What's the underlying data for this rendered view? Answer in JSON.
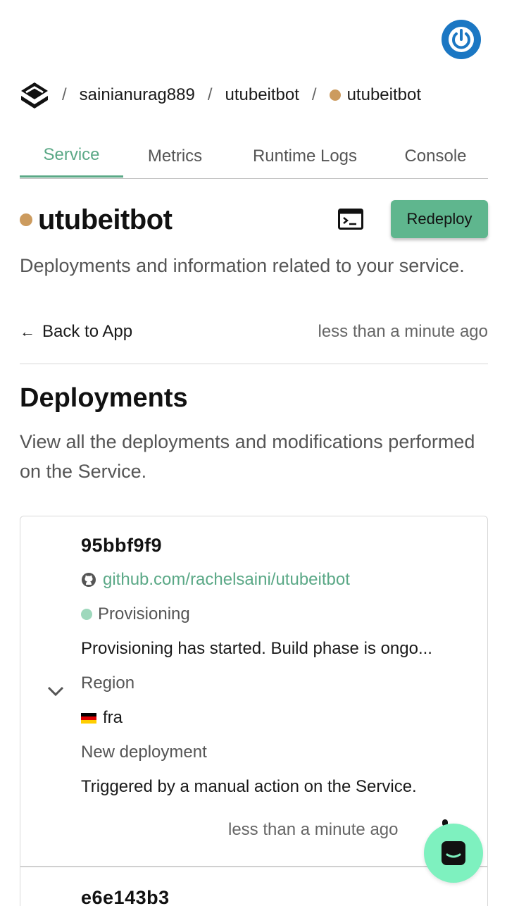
{
  "breadcrumb": {
    "user": "sainianurag889",
    "app": "utubeitbot",
    "service": "utubeitbot",
    "separator": "/"
  },
  "tabs": [
    {
      "label": "Service",
      "active": true
    },
    {
      "label": "Metrics",
      "active": false
    },
    {
      "label": "Runtime Logs",
      "active": false
    },
    {
      "label": "Console",
      "active": false
    }
  ],
  "service": {
    "name": "utubeitbot",
    "status_color": "#cc9b5e",
    "redeploy_label": "Redeploy",
    "description": "Deployments and information related to your service.",
    "back_label": "Back to App",
    "back_arrow": "←",
    "updated": "less than a minute ago"
  },
  "deployments": {
    "title": "Deployments",
    "description": "View all the deployments and modifications performed on the Service.",
    "items": [
      {
        "id": "95bbf9f9",
        "repo": "github.com/rachelsaini/utubeitbot",
        "status": "Provisioning",
        "status_color": "#9ed8bc",
        "message": "Provisioning has started. Build phase is ongo...",
        "region_label": "Region",
        "region": "fra",
        "event": "New deployment",
        "trigger": "Triggered by a manual action on the Service.",
        "time": "less than a minute ago"
      },
      {
        "id": "e6e143b3"
      }
    ]
  },
  "colors": {
    "accent": "#5aa886",
    "button": "#5fb68e",
    "power": "#1b77c3",
    "chat": "#7ef1bf"
  }
}
